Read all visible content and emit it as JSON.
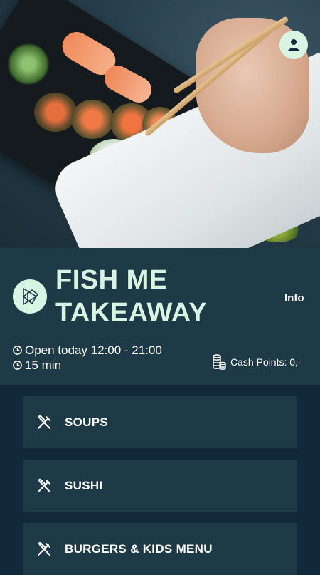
{
  "colors": {
    "background": "#11293a",
    "band": "#1f3a47",
    "accent": "#d8f5e4",
    "text": "#ffffff"
  },
  "header": {
    "profile_icon": "user-icon"
  },
  "restaurant": {
    "logo_icon": "fish-logo-icon",
    "name": "FISH ME TAKEAWAY",
    "info_label": "Info",
    "hours_text": "Open today 12:00 - 21:00",
    "wait_text": "15 min",
    "cash_points_text": "Cash Points: 0,-"
  },
  "categories": [
    {
      "label": "SOUPS",
      "icon": "cutlery-icon"
    },
    {
      "label": "SUSHI",
      "icon": "cutlery-icon"
    },
    {
      "label": "BURGERS & KIDS MENU",
      "icon": "cutlery-icon"
    }
  ]
}
